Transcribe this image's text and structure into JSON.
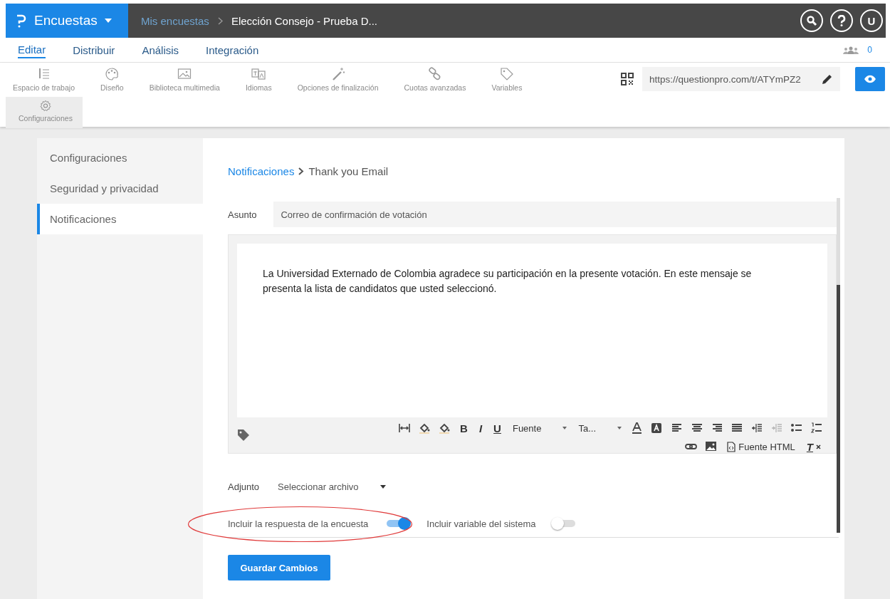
{
  "app": {
    "name": "Encuestas"
  },
  "breadcrumb": {
    "parent": "Mis encuestas",
    "current": "Elección Consejo - Prueba D..."
  },
  "header_user": {
    "initial": "U"
  },
  "tabs": [
    {
      "label": "Editar",
      "selected": true
    },
    {
      "label": "Distribuir",
      "selected": false
    },
    {
      "label": "Análisis",
      "selected": false
    },
    {
      "label": "Integración",
      "selected": false
    }
  ],
  "collaborators": {
    "count": "0"
  },
  "tools": [
    {
      "kind": "workspace",
      "label": "Espacio de trabajo",
      "selected": false
    },
    {
      "kind": "palette",
      "label": "Diseño",
      "selected": false
    },
    {
      "kind": "image",
      "label": "Biblioteca multimedia",
      "selected": false
    },
    {
      "kind": "translate",
      "label": "Idiomas",
      "selected": false
    },
    {
      "kind": "wand",
      "label": "Opciones de finalización",
      "selected": false
    },
    {
      "kind": "links",
      "label": "Cuotas avanzadas",
      "selected": false
    },
    {
      "kind": "tag",
      "label": "Variables",
      "selected": false
    },
    {
      "kind": "gear",
      "label": "Configuraciones",
      "selected": true
    }
  ],
  "survey_url": {
    "value": "https://questionpro.com/t/ATYmPZ2"
  },
  "sidebar": {
    "items": [
      {
        "label": "Configuraciones",
        "selected": false
      },
      {
        "label": "Seguridad y privacidad",
        "selected": false
      },
      {
        "label": "Notificaciones",
        "selected": true
      }
    ]
  },
  "content": {
    "breadcrumb": {
      "parent": "Notificaciones",
      "current": "Thank you Email"
    },
    "subject": {
      "label": "Asunto",
      "value": "Correo de confirmación de votación"
    },
    "body": "La Universidad Externado de Colombia agradece su participación en la presente votación. En este mensaje se presenta la lista de candidatos que usted seleccionó.",
    "editor_toolbar": [
      [
        {
          "kind": "width"
        },
        {
          "kind": "fill"
        },
        {
          "kind": "fill"
        },
        {
          "kind": "bold",
          "text": "B"
        },
        {
          "kind": "italic",
          "text": "I"
        },
        {
          "kind": "underline",
          "text": "U"
        },
        {
          "kind": "dropdown",
          "text": "Fuente"
        },
        {
          "kind": "dropdown",
          "text": "Ta..."
        },
        {
          "kind": "textcolor"
        },
        {
          "kind": "bgcolor"
        },
        {
          "kind": "align-left"
        },
        {
          "kind": "align-center"
        },
        {
          "kind": "align-right"
        },
        {
          "kind": "justify"
        },
        {
          "kind": "indent"
        },
        {
          "kind": "outdent",
          "disabled": true
        },
        {
          "kind": "bullets"
        },
        {
          "kind": "numbers"
        }
      ],
      [
        {
          "kind": "link"
        },
        {
          "kind": "picture-btn"
        },
        {
          "kind": "source",
          "text": "Fuente HTML"
        },
        {
          "kind": "clear-format",
          "text": "T"
        }
      ]
    ],
    "attachment": {
      "label": "Adjunto",
      "value": "Seleccionar archivo"
    },
    "toggles": [
      {
        "label": "Incluir la respuesta de la encuesta",
        "on": true
      },
      {
        "label": "Incluir variable del sistema",
        "on": false
      }
    ],
    "save_button": "Guardar Cambios"
  }
}
